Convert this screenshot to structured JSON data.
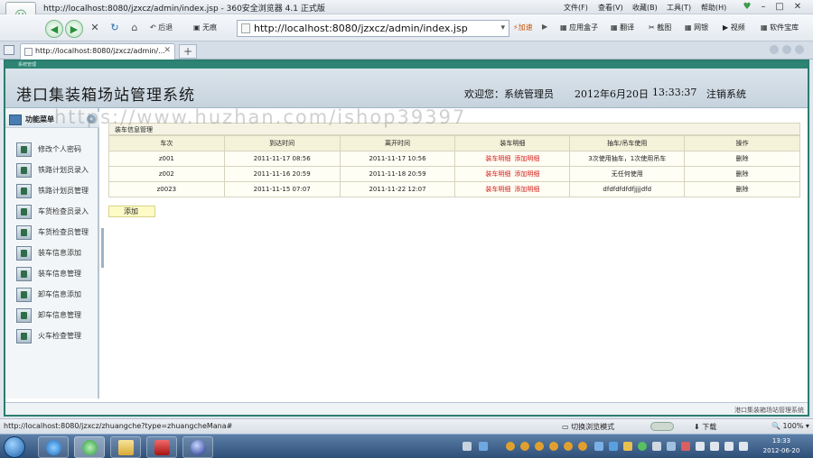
{
  "browser": {
    "title": "http://localhost:8080/jzxcz/admin/index.jsp - 360安全浏览器 4.1 正式版",
    "menu": [
      "文件(F)",
      "查看(V)",
      "收藏(B)",
      "工具(T)",
      "帮助(H)"
    ],
    "nav": {
      "back_label": "后退",
      "home_label": "无痕"
    },
    "address": "http://localhost:8080/jzxcz/admin/index.jsp",
    "accelerate": "加速",
    "toolbar": [
      "应用盒子",
      "翻译",
      "截图",
      "网银",
      "视频",
      "软件宝库"
    ],
    "tab_title": "http://localhost:8080/jzxcz/admin/..."
  },
  "app": {
    "strip_title": "系统管理",
    "system_title": "港口集装箱场站管理系统",
    "welcome": "欢迎您：系统管理员",
    "date": "2012年6月20日",
    "time": "13:33:37",
    "logout": "注销系统",
    "sidebar": {
      "header": "功能菜单",
      "items": [
        {
          "label": "修改个人密码"
        },
        {
          "label": "铁路计划员录入"
        },
        {
          "label": "铁路计划员管理"
        },
        {
          "label": "车货检查员录入"
        },
        {
          "label": "车货检查员管理"
        },
        {
          "label": "装车信息添加"
        },
        {
          "label": "装车信息管理"
        },
        {
          "label": "卸车信息添加"
        },
        {
          "label": "卸车信息管理"
        },
        {
          "label": "火车检查管理"
        }
      ]
    },
    "breadcrumb": "装车信息管理",
    "table": {
      "headers": [
        "车次",
        "到达时间",
        "离开时间",
        "装车明细",
        "抽车/吊车使用",
        "操作"
      ],
      "rows": [
        {
          "train": "z001",
          "arrive": "2011-11-17 08:56",
          "leave": "2011-11-17 10:56",
          "detail_link": "装车明细",
          "add_link": "添加明细",
          "usage": "3次使用抽车，1次使用吊车",
          "op": "删除"
        },
        {
          "train": "z002",
          "arrive": "2011-11-16 20:59",
          "leave": "2011-11-18 20:59",
          "detail_link": "装车明细",
          "add_link": "添加明细",
          "usage": "无任何使用",
          "op": "删除"
        },
        {
          "train": "z0023",
          "arrive": "2011-11-15 07:07",
          "leave": "2011-11-22 12:07",
          "detail_link": "装车明细",
          "add_link": "添加明细",
          "usage": "dfdfdfdfdfjjjjdfd",
          "op": "删除"
        }
      ]
    },
    "add_button": "添加",
    "footer": "港口集装箱场站管理系统"
  },
  "statusbar": {
    "url": "http://localhost:8080/jzxcz/zhuangche?type=zhuangcheMana#",
    "mode": "切换浏览模式",
    "download": "下载",
    "zoom": "100%"
  },
  "taskbar": {
    "time": "13:33",
    "date": "2012-06-20"
  },
  "watermark": "https://www.huzhan.com/ishop39397"
}
